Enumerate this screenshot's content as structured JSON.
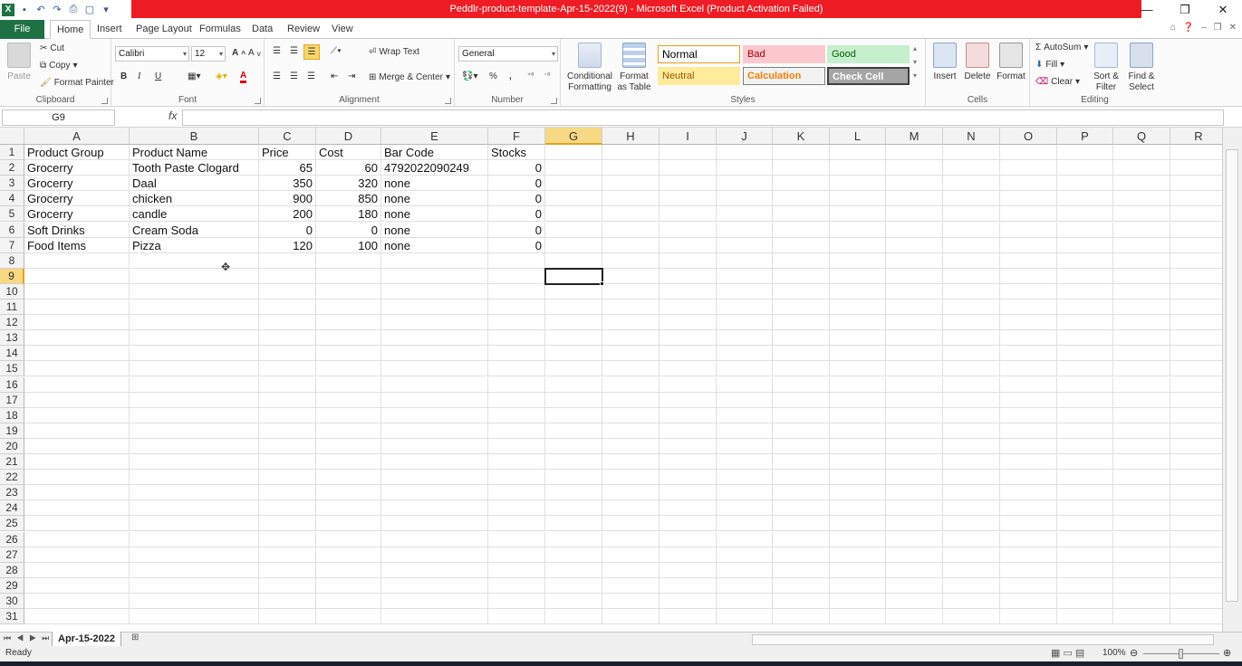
{
  "window": {
    "title": "Peddlr-product-template-Apr-15-2022(9)  -  Microsoft Excel (Product Activation Failed)"
  },
  "tabs": [
    "File",
    "Home",
    "Insert",
    "Page Layout",
    "Formulas",
    "Data",
    "Review",
    "View"
  ],
  "active_tab": "Home",
  "ribbon": {
    "clipboard": {
      "label": "Clipboard",
      "paste": "Paste",
      "cut": "Cut",
      "copy": "Copy",
      "format_painter": "Format Painter"
    },
    "font": {
      "label": "Font",
      "name": "Calibri",
      "size": "12",
      "bold": "B",
      "italic": "I",
      "underline": "U"
    },
    "alignment": {
      "label": "Alignment",
      "wrap_text": "Wrap Text",
      "merge_center": "Merge & Center"
    },
    "number": {
      "label": "Number",
      "format": "General",
      "percent": "%",
      "comma": ","
    },
    "styles": {
      "label": "Styles",
      "conditional": "Conditional Formatting",
      "format_table": "Format as Table",
      "normal": "Normal",
      "bad": "Bad",
      "good": "Good",
      "neutral": "Neutral",
      "calculation": "Calculation",
      "check_cell": "Check Cell"
    },
    "cells": {
      "label": "Cells",
      "insert": "Insert",
      "delete": "Delete",
      "format": "Format"
    },
    "editing": {
      "label": "Editing",
      "autosum": "AutoSum",
      "fill": "Fill",
      "clear": "Clear",
      "sort_filter": "Sort & Filter",
      "find_select": "Find & Select"
    }
  },
  "formula_bar": {
    "name_box": "G9",
    "fx": "fx",
    "value": ""
  },
  "columns": [
    "A",
    "B",
    "C",
    "D",
    "E",
    "F",
    "G",
    "H",
    "I",
    "J",
    "K",
    "L",
    "M",
    "N",
    "O",
    "P",
    "Q",
    "R"
  ],
  "selected_column": "G",
  "selected_row": 9,
  "rows_visible": 31,
  "sheet": {
    "headers": [
      "Product Group",
      "Product Name",
      "Price",
      "Cost",
      "Bar Code",
      "Stocks"
    ],
    "rows": [
      [
        "Grocerry",
        "Tooth Paste Clogard",
        "65",
        "60",
        "4792022090249",
        "0"
      ],
      [
        "Grocerry",
        "Daal",
        "350",
        "320",
        "none",
        "0"
      ],
      [
        "Grocerry",
        "chicken",
        "900",
        "850",
        "none",
        "0"
      ],
      [
        "Grocerry",
        "candle",
        "200",
        "180",
        "none",
        "0"
      ],
      [
        "Soft Drinks",
        "Cream Soda",
        "0",
        "0",
        "none",
        "0"
      ],
      [
        "Food Items",
        "Pizza",
        "120",
        "100",
        "none",
        "0"
      ]
    ]
  },
  "sheet_tab": "Apr-15-2022",
  "status": {
    "ready": "Ready",
    "zoom": "100%"
  },
  "colors": {
    "excel_green": "#1e7145",
    "title_red": "#ee1c24",
    "selection_header": "#f7d883"
  }
}
